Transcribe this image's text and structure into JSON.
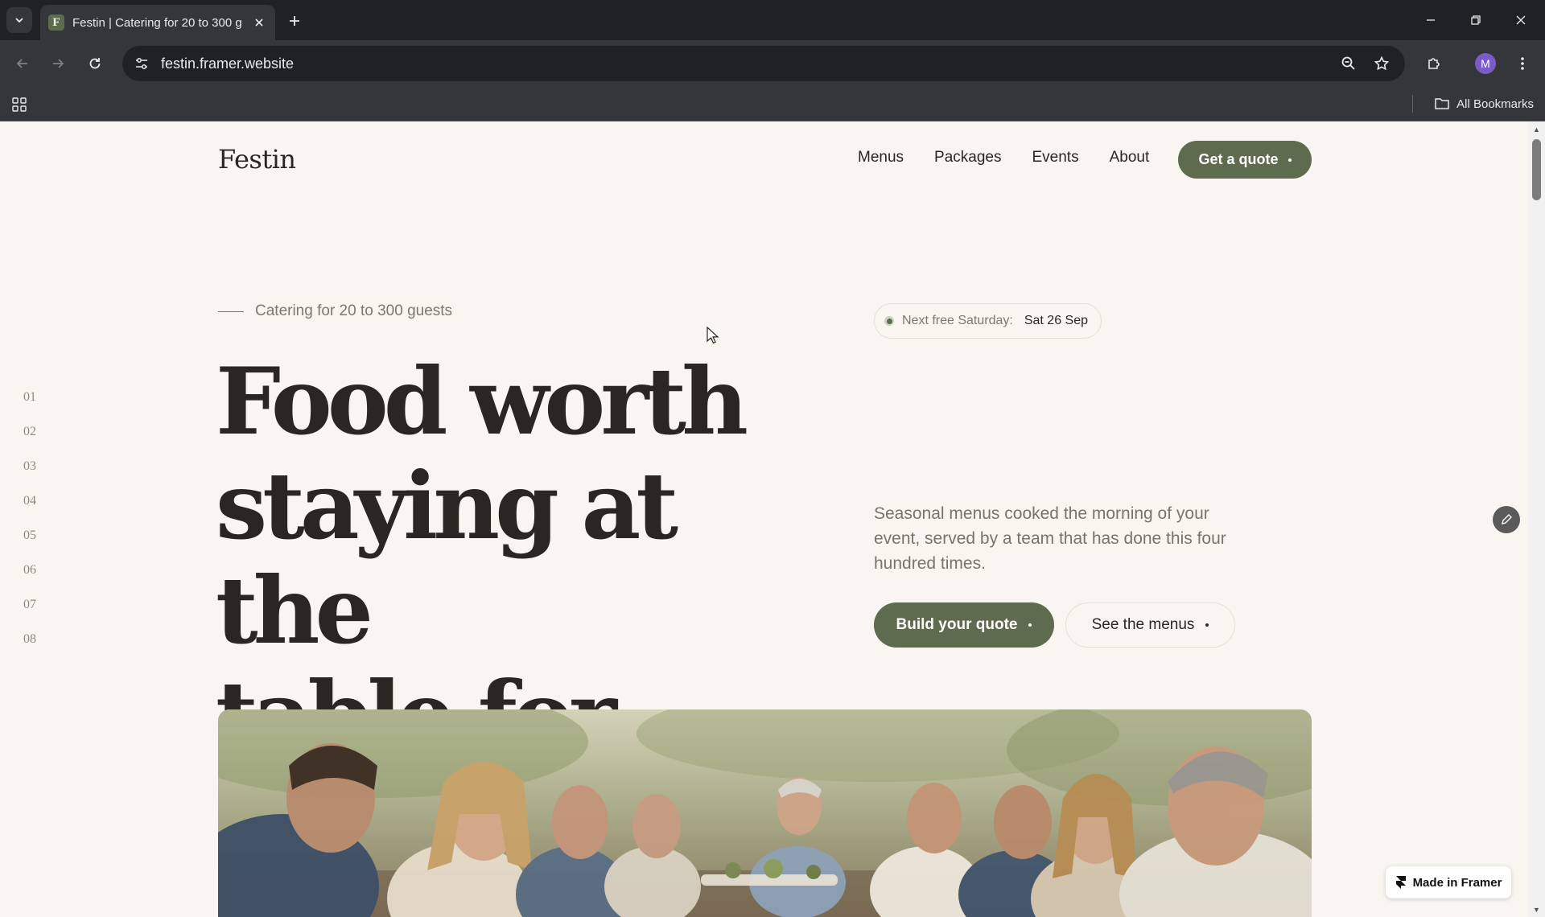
{
  "browser": {
    "tab_title": "Festin | Catering for 20 to 300 g",
    "favicon_letter": "F",
    "url": "festin.framer.website",
    "bookmarks_label": "All Bookmarks",
    "profile_initial": "M"
  },
  "site": {
    "logo": "Festin",
    "nav": [
      "Menus",
      "Packages",
      "Events",
      "About"
    ],
    "cta_top": "Get a quote"
  },
  "side_index": [
    "01",
    "02",
    "03",
    "04",
    "05",
    "06",
    "07",
    "08"
  ],
  "hero": {
    "eyebrow": "Catering for 20 to 300 guests",
    "headline_lines": [
      "Food worth",
      "staying at the",
      "table for."
    ],
    "badge_label": "Next free Saturday:",
    "badge_value": "Sat 26 Sep",
    "intro": "Seasonal menus cooked the morning of your event, served by a team that has done this four hundred times.",
    "primary_button": "Build your quote",
    "secondary_button": "See the menus"
  },
  "framer_badge": "Made in Framer",
  "colors": {
    "accent": "#5e6b4e",
    "page_bg": "#f9f6f1",
    "text": "#2b2622",
    "muted": "#7a736a",
    "chrome_dark": "#202124",
    "chrome_toolbar": "#35363a"
  }
}
